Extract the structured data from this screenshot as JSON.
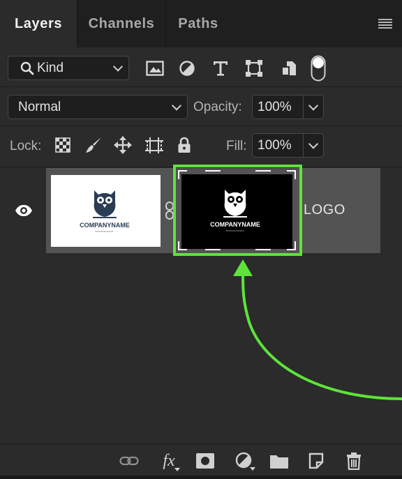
{
  "tabs": [
    {
      "label": "Layers",
      "active": true
    },
    {
      "label": "Channels",
      "active": false
    },
    {
      "label": "Paths",
      "active": false
    }
  ],
  "filter": {
    "kind_label": "Kind",
    "icons": [
      "image-filter-icon",
      "adjustment-filter-icon",
      "type-filter-icon",
      "shape-filter-icon",
      "smart-object-filter-icon",
      "filter-toggle-icon"
    ]
  },
  "blend": {
    "mode": "Normal",
    "opacity_label": "Opacity:",
    "opacity_value": "100%"
  },
  "lock": {
    "label": "Lock:",
    "icons": [
      "lock-transparent-pixels-icon",
      "lock-image-pixels-icon",
      "lock-position-icon",
      "lock-artboard-icon",
      "lock-all-icon"
    ],
    "fill_label": "Fill:",
    "fill_value": "100%"
  },
  "layer": {
    "name": "LOGO",
    "visible": true,
    "thumb_logo_text": "COMPANYNAME",
    "mask_logo_text": "COMPANYNAME"
  },
  "bottom_icons": [
    "link-layers-icon",
    "fx-icon",
    "add-mask-icon",
    "new-adjustment-icon",
    "new-group-icon",
    "new-layer-icon",
    "delete-icon"
  ],
  "bottom_fx_label": "fx",
  "colors": {
    "highlight": "#5ee33a",
    "panel_bg": "#2b2b2b",
    "selected_row": "#535353"
  }
}
